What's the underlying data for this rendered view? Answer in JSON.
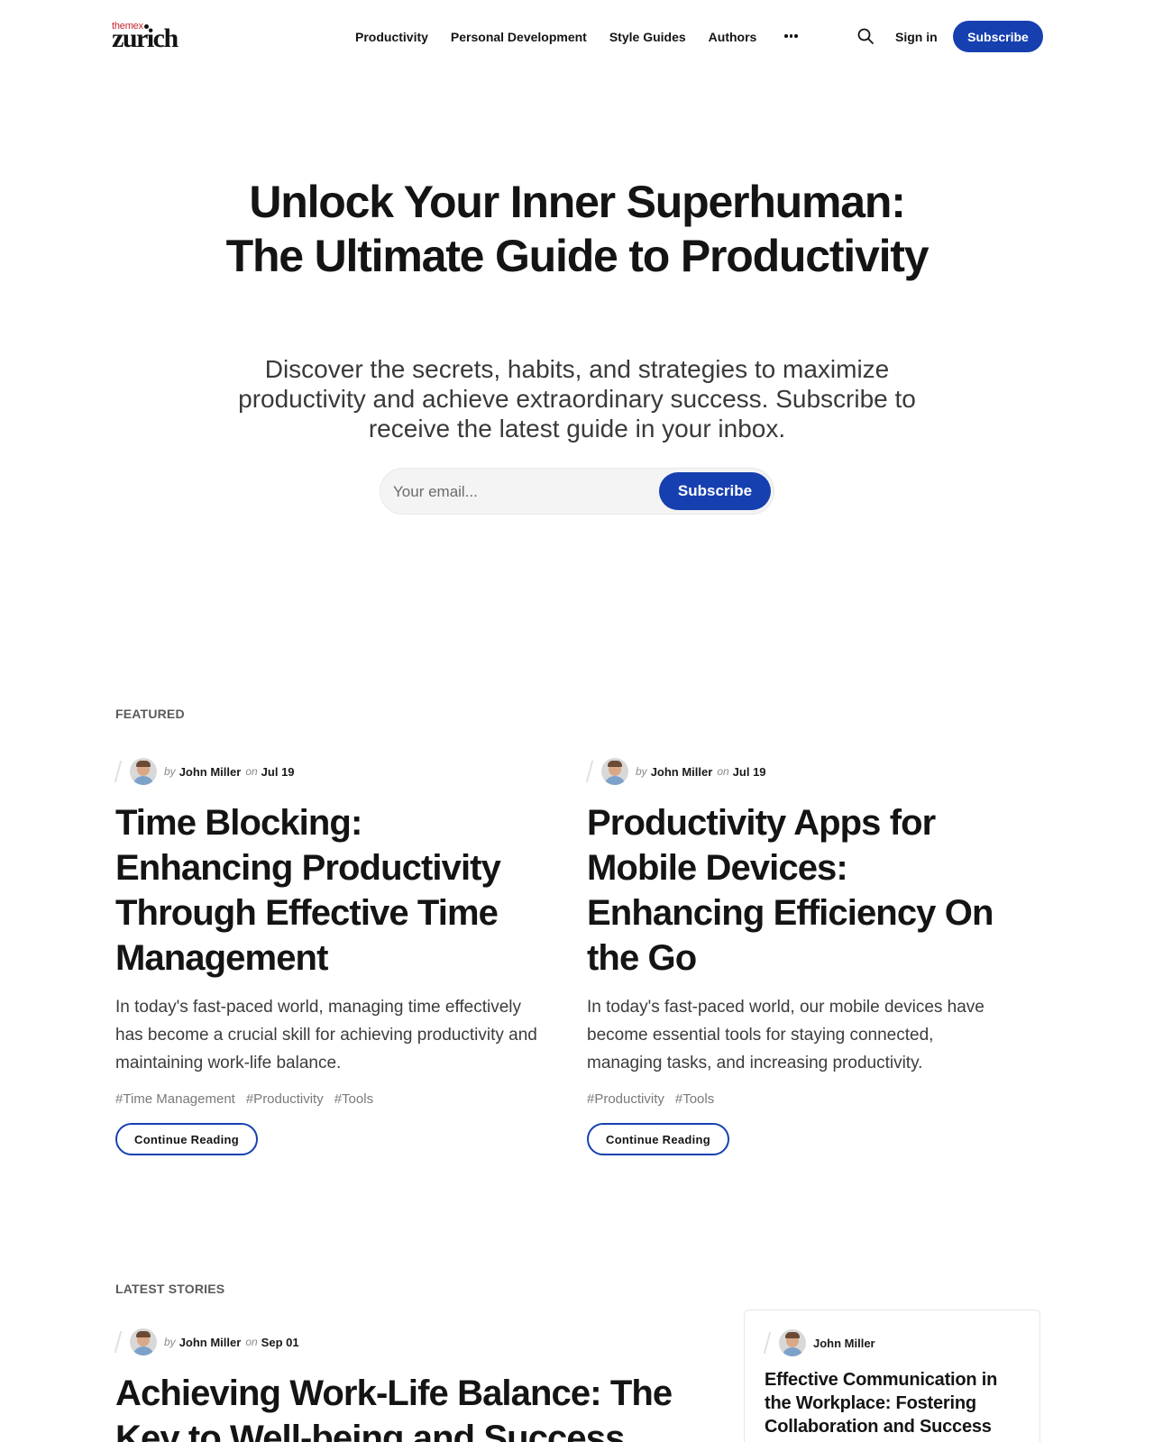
{
  "header": {
    "logo_small": "themex",
    "logo_big": "zurich",
    "nav": [
      "Productivity",
      "Personal Development",
      "Style Guides",
      "Authors"
    ],
    "signin_label": "Sign in",
    "subscribe_label": "Subscribe"
  },
  "hero": {
    "title": "Unlock Your Inner Superhuman: The Ultimate Guide to Productivity",
    "subtitle": "Discover the secrets, habits, and strategies to maximize productivity and achieve extraordinary success. Subscribe to receive the latest guide in your inbox.",
    "email_placeholder": "Your email...",
    "subscribe_label": "Subscribe"
  },
  "featured": {
    "label": "FEATURED",
    "posts": [
      {
        "by": "by",
        "author": "John Miller",
        "on": "on",
        "date": "Jul 19",
        "title": "Time Blocking: Enhancing Productivity Through Effective Time Management",
        "excerpt": "In today's fast-paced world, managing time effectively has become a crucial skill for achieving productivity and maintaining work-life balance.",
        "tags": [
          "#Time Management",
          "#Productivity",
          "#Tools"
        ],
        "cta": "Continue Reading"
      },
      {
        "by": "by",
        "author": "John Miller",
        "on": "on",
        "date": "Jul 19",
        "title": "Productivity Apps for Mobile Devices: Enhancing Efficiency On the Go",
        "excerpt": "In today's fast-paced world, our mobile devices have become essential tools for staying connected, managing tasks, and increasing productivity.",
        "tags": [
          "#Productivity",
          "#Tools"
        ],
        "cta": "Continue Reading"
      }
    ]
  },
  "latest": {
    "label": "LATEST STORIES",
    "main": {
      "by": "by",
      "author": "John Miller",
      "on": "on",
      "date": "Sep 01",
      "title": "Achieving Work-Life Balance: The Key to Well-being and Success"
    },
    "side": {
      "author": "John Miller",
      "title": "Effective Communication in the Workplace: Fostering Collaboration and Success"
    }
  },
  "colors": {
    "accent": "#1640b0",
    "logo_red": "#c4262e",
    "text": "#141414"
  },
  "icons": [
    "search-icon",
    "more-dots-icon",
    "avatar"
  ]
}
